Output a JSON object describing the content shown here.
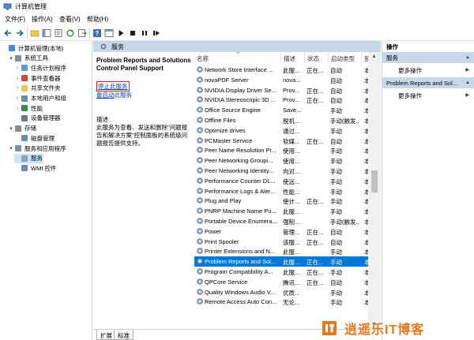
{
  "window": {
    "title": "计算机管理"
  },
  "menu": [
    "文件(F)",
    "操作(A)",
    "查看(V)",
    "帮助(H)"
  ],
  "tree": {
    "items": [
      {
        "label": "计算机管理(本地)",
        "expander": "",
        "icon": "computer-icon",
        "level": 0
      },
      {
        "label": "系统工具",
        "expander": "▾",
        "icon": "tools-icon",
        "level": 1
      },
      {
        "label": "任务计划程序",
        "expander": "›",
        "icon": "clock-icon",
        "level": 2
      },
      {
        "label": "事件查看器",
        "expander": "›",
        "icon": "event-viewer-icon",
        "level": 2
      },
      {
        "label": "共享文件夹",
        "expander": "›",
        "icon": "shared-folder-icon",
        "level": 2
      },
      {
        "label": "本地用户和组",
        "expander": "›",
        "icon": "users-icon",
        "level": 2
      },
      {
        "label": "性能",
        "expander": "›",
        "icon": "performance-icon",
        "level": 2
      },
      {
        "label": "设备管理器",
        "expander": "",
        "icon": "device-manager-icon",
        "level": 2
      },
      {
        "label": "存储",
        "expander": "▾",
        "icon": "storage-icon",
        "level": 1
      },
      {
        "label": "磁盘管理",
        "expander": "",
        "icon": "disk-icon",
        "level": 2
      },
      {
        "label": "服务和应用程序",
        "expander": "▾",
        "icon": "services-apps-icon",
        "level": 1
      },
      {
        "label": "服务",
        "expander": "",
        "icon": "services-icon",
        "level": 2,
        "selected": true
      },
      {
        "label": "WMI 控件",
        "expander": "",
        "icon": "wmi-icon",
        "level": 2
      }
    ]
  },
  "middle": {
    "header": "服务",
    "desc": {
      "title": "Problem Reports and Solutions Control Panel Support",
      "stop_link": "停止此服务",
      "restart_link_prefix": "重启动",
      "restart_link_suffix": "此服务",
      "label": "描述:",
      "text": "此服务为查看、发送和删除\"问题报告和解决方案\"控制面板的系统级问题报告提供支持。"
    },
    "columns": {
      "name": "名称",
      "desc": "描述",
      "status": "状态",
      "startup": "启动类型",
      "logon": "登"
    },
    "rows": [
      {
        "name": "Network Store Interface ...",
        "desc": "此服...",
        "status": "正在...",
        "startup": "自动",
        "logon": "本"
      },
      {
        "name": "novaPDF Server",
        "desc": "nova...",
        "status": "",
        "startup": "自动",
        "logon": "本"
      },
      {
        "name": "NVIDIA Display Driver Se...",
        "desc": "Prov...",
        "status": "正在...",
        "startup": "自动",
        "logon": "本"
      },
      {
        "name": "NVIDIA Stereoscopic 3D ...",
        "desc": "Prov...",
        "status": "正在...",
        "startup": "自动",
        "logon": "本"
      },
      {
        "name": "Office  Source Engine",
        "desc": "Save...",
        "status": "",
        "startup": "手动",
        "logon": "本"
      },
      {
        "name": "Offline Files",
        "desc": "脱机...",
        "status": "",
        "startup": "手动(触发...",
        "logon": "本"
      },
      {
        "name": "Optimize drives",
        "desc": "通过...",
        "status": "",
        "startup": "手动",
        "logon": "本"
      },
      {
        "name": "PCMaster Service",
        "desc": "软媒...",
        "status": "正在...",
        "startup": "自动",
        "logon": "本"
      },
      {
        "name": "Peer Name Resolution Pr...",
        "desc": "使用...",
        "status": "",
        "startup": "手动",
        "logon": "本"
      },
      {
        "name": "Peer Networking Groupi...",
        "desc": "使用...",
        "status": "",
        "startup": "手动",
        "logon": "本"
      },
      {
        "name": "Peer Networking Identity...",
        "desc": "向对...",
        "status": "",
        "startup": "手动",
        "logon": "本"
      },
      {
        "name": "Performance Counter DL...",
        "desc": "使远...",
        "status": "",
        "startup": "手动",
        "logon": "本"
      },
      {
        "name": "Performance Logs & Aler...",
        "desc": "性能...",
        "status": "",
        "startup": "手动",
        "logon": "本"
      },
      {
        "name": "Plug and Play",
        "desc": "使计...",
        "status": "正在...",
        "startup": "手动",
        "logon": "本"
      },
      {
        "name": "PNRP Machine Name Pu...",
        "desc": "此服...",
        "status": "",
        "startup": "手动",
        "logon": "本"
      },
      {
        "name": "Portable Device Enumera...",
        "desc": "强制...",
        "status": "",
        "startup": "手动(触发...",
        "logon": "本"
      },
      {
        "name": "Power",
        "desc": "管理...",
        "status": "正在...",
        "startup": "自动",
        "logon": "本"
      },
      {
        "name": "Print Spooler",
        "desc": "该服...",
        "status": "正在...",
        "startup": "自动",
        "logon": "本"
      },
      {
        "name": "Printer Extensions and N...",
        "desc": "此服...",
        "status": "",
        "startup": "手动",
        "logon": "本"
      },
      {
        "name": "Problem Reports and Sol...",
        "desc": "此服...",
        "status": "正在...",
        "startup": "手动",
        "logon": "本",
        "selected": true
      },
      {
        "name": "Program Compatibility A...",
        "desc": "此服...",
        "status": "正在...",
        "startup": "手动",
        "logon": "本"
      },
      {
        "name": "QPCore Service",
        "desc": "腾讯...",
        "status": "正在...",
        "startup": "自动",
        "logon": "本"
      },
      {
        "name": "Quality Windows Audio V...",
        "desc": "优质...",
        "status": "",
        "startup": "手动",
        "logon": "本"
      },
      {
        "name": "Remote Access Auto Con...",
        "desc": "无论...",
        "status": "",
        "startup": "手动",
        "logon": "本"
      }
    ],
    "tabs": [
      "扩展",
      "标准"
    ]
  },
  "actions": {
    "header": "操作",
    "group1": "服务",
    "more1": "更多操作",
    "group2": "Problem Reports and Sol...",
    "more2": "更多操作"
  },
  "watermark": {
    "text": "逍遥乐IT博客"
  },
  "colors": {
    "selection": "#0078d7",
    "header_bg": "#c7d8ea",
    "watermark": "#e8781d",
    "stop_link_border": "#d0202e"
  }
}
